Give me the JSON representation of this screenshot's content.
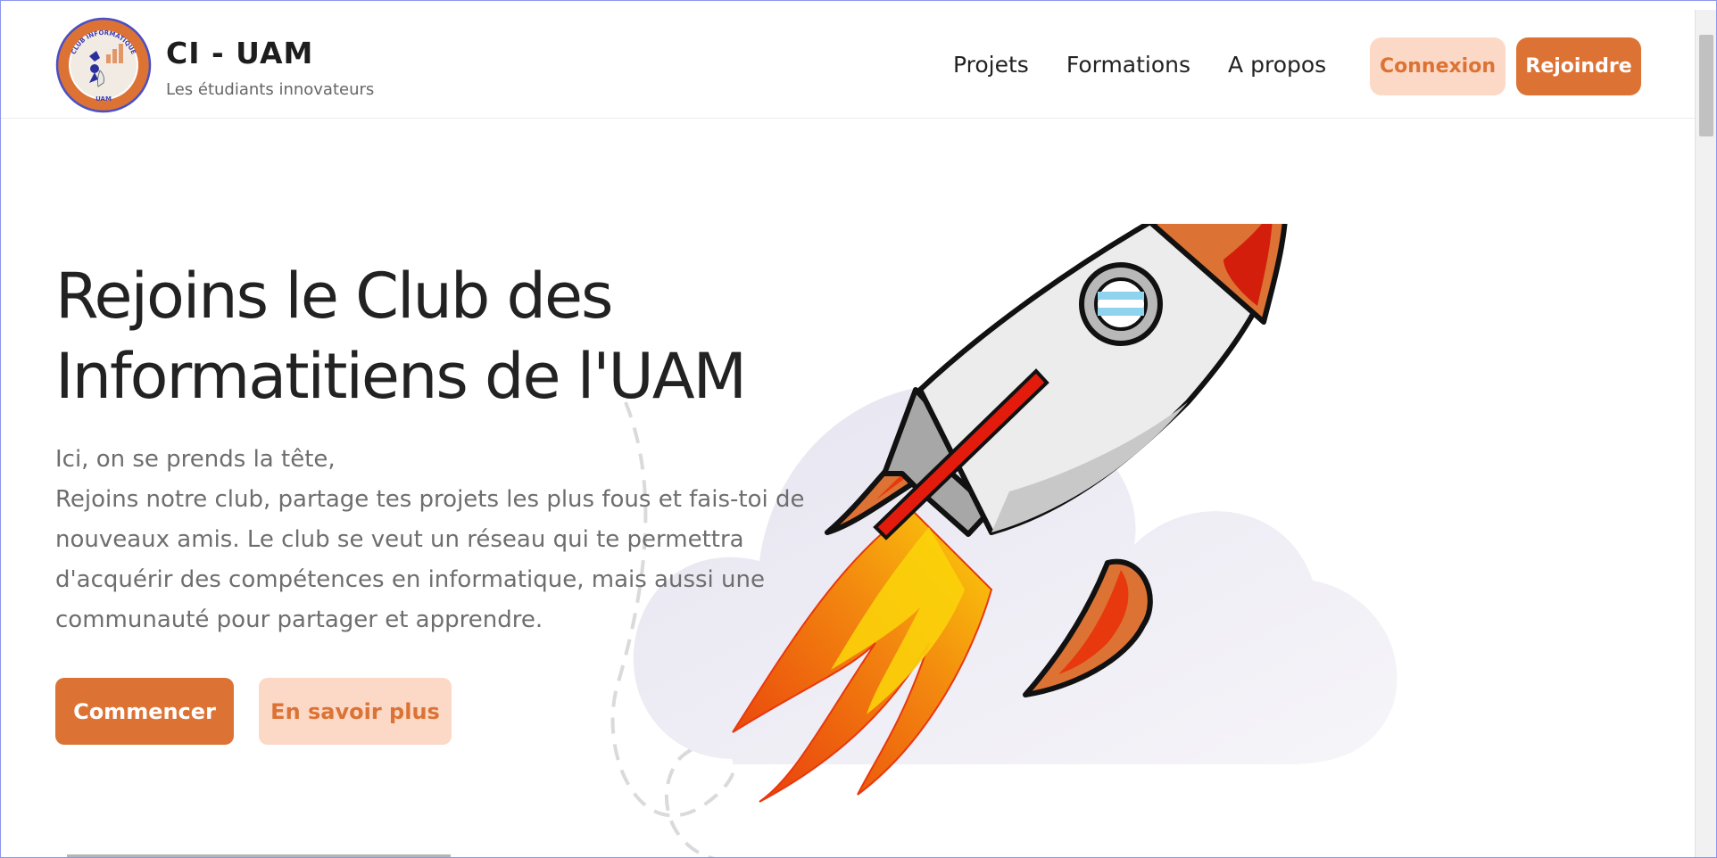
{
  "brand": {
    "title": "CI - UAM",
    "subtitle": "Les étudiants innovateurs",
    "logo_text_top": "CLUB INFORMATIQUE",
    "logo_text_bottom": "UAM"
  },
  "nav": {
    "items": [
      {
        "label": "Projets"
      },
      {
        "label": "Formations"
      },
      {
        "label": "A propos"
      }
    ],
    "login_label": "Connexion",
    "join_label": "Rejoindre"
  },
  "hero": {
    "title_line1": "Rejoins le Club des",
    "title_line2": "Informatitiens de l'UAM",
    "text_line1": "Ici, on se prends la tête,",
    "text_line2": "Rejoins notre club, partage tes projets les plus fous et fais-toi de nouveaux amis. Le club se veut un réseau qui te permettra d'acquérir des compétences en informatique, mais aussi une communauté pour partager et apprendre.",
    "start_label": "Commencer",
    "more_label": "En savoir plus"
  },
  "colors": {
    "accent": "#dc7335",
    "accent_light": "#fcd9c6",
    "text_dark": "#222222",
    "text_muted": "#6e6e6e"
  },
  "icons": {
    "illustration": "rocket-illustration",
    "logo": "club-logo-icon"
  }
}
